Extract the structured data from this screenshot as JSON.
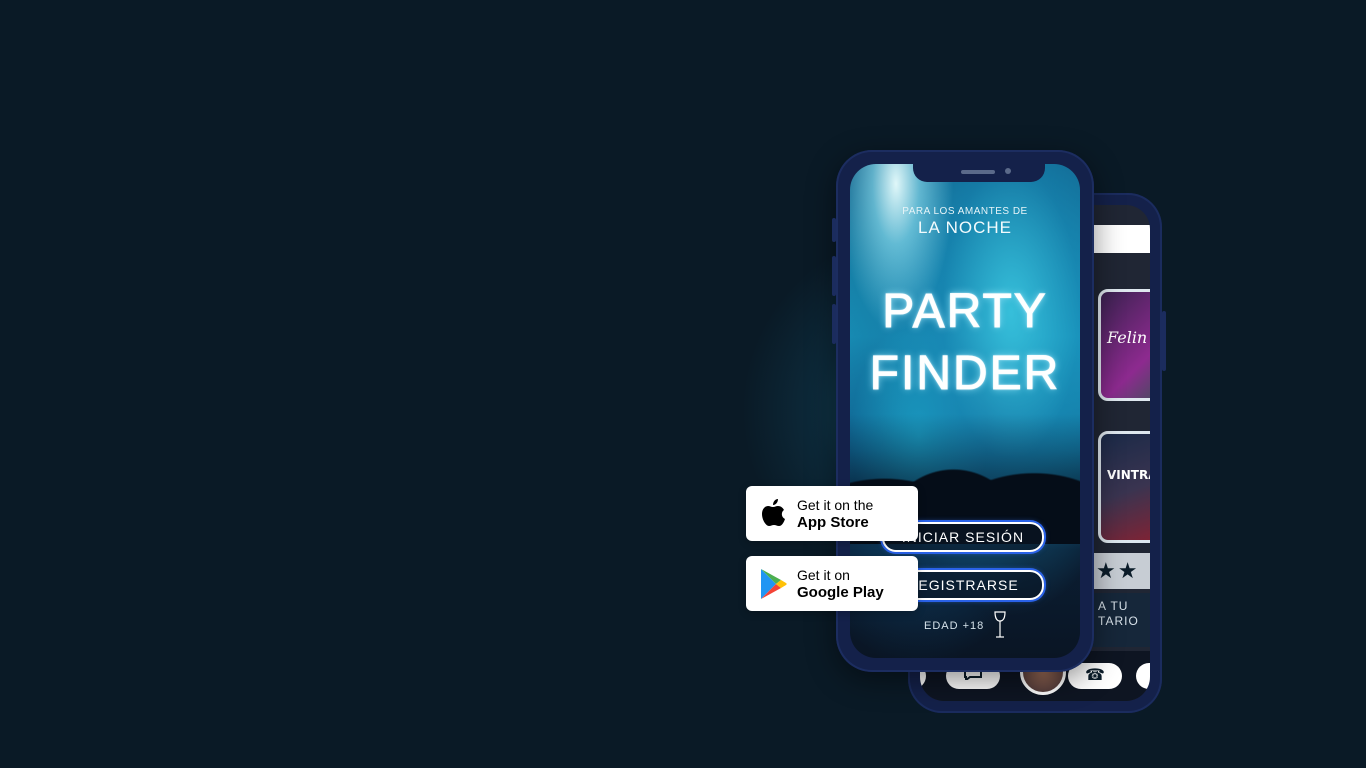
{
  "hero": {
    "tagline_small": "PARA LOS AMANTES DE",
    "tagline_big": "LA NOCHE",
    "title_line1": "PARTY",
    "title_line2": "FINDER",
    "login_label": "INICIAR SESIÓN",
    "register_label": "REGISTRARSE",
    "age_label": "EDAD +18"
  },
  "back_screen": {
    "card1_label": "Felin",
    "card2_label": "VINTRASH",
    "stars": "★★",
    "comment_line1": "A TU",
    "comment_line2": "TARIO"
  },
  "badges": {
    "appstore_small": "Get it on the",
    "appstore_big": "App Store",
    "gplay_small": "Get it on",
    "gplay_big": "Google Play"
  },
  "colors": {
    "background": "#0a1a26",
    "phone_frame": "#14214a",
    "button_glow": "#2a62e8"
  }
}
